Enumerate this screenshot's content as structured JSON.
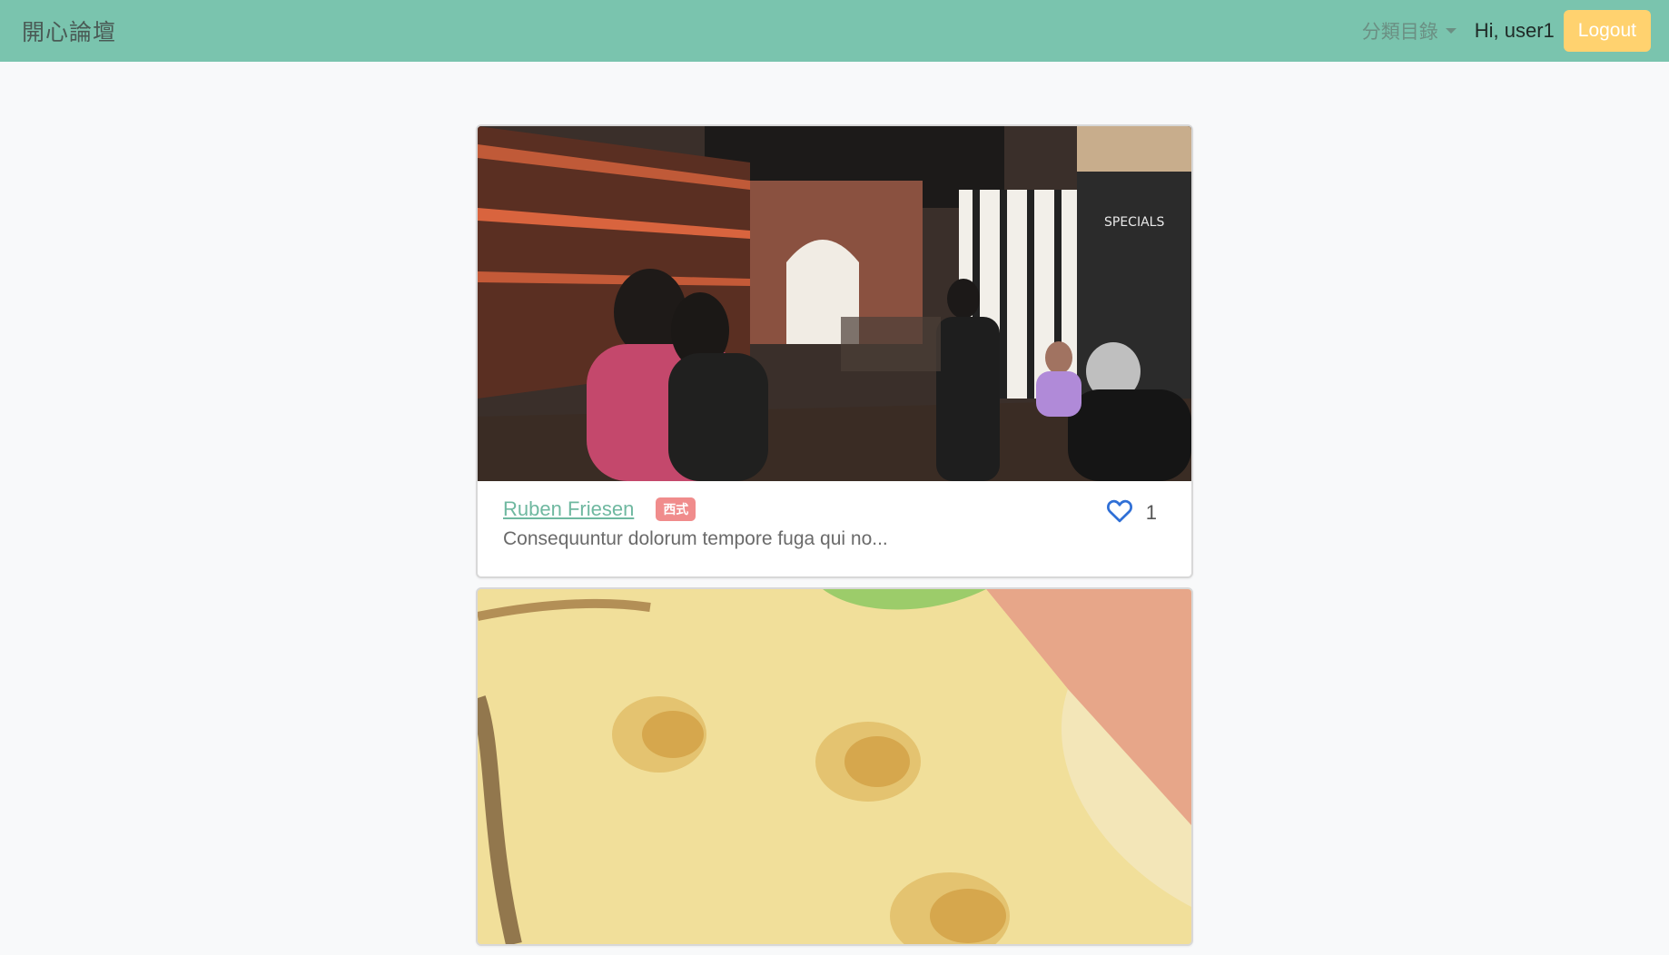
{
  "navbar": {
    "brand": "開心論壇",
    "category_menu_label": "分類目錄",
    "greeting": "Hi, user1",
    "logout_label": "Logout"
  },
  "feed": {
    "cards": [
      {
        "restaurant_name": "Ruben Friesen",
        "category": "西式",
        "description": "Consequuntur dolorum tempore fuga qui no...",
        "like_count": "1"
      }
    ]
  },
  "colors": {
    "navbar_bg": "#7ac4ae",
    "logout_bg": "#ffd26f",
    "link": "#6fb8a0",
    "badge": "#f08c8c",
    "heart": "#2f6fd6"
  },
  "icons": {
    "like": "heart-outline-icon",
    "dropdown": "caret-down-icon"
  }
}
